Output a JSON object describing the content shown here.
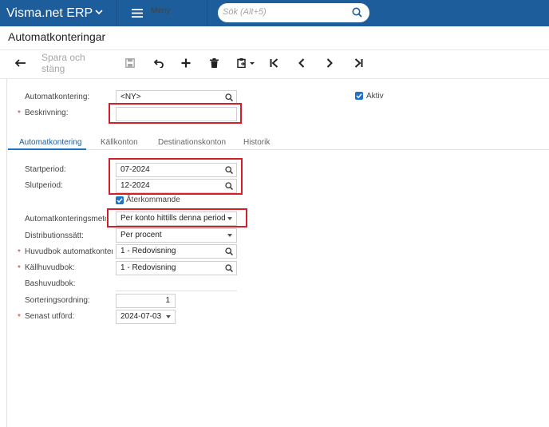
{
  "topbar": {
    "brand": "Visma.net ERP",
    "menu_label": "Meny",
    "search_placeholder": "Sök (Alt+5)"
  },
  "page": {
    "title": "Automatkonteringar"
  },
  "toolbar": {
    "save_close_label": "Spara och stäng"
  },
  "header": {
    "automatkontering_label": "Automatkontering:",
    "automatkontering_value": "<NY>",
    "beskrivning_label": "Beskrivning:",
    "beskrivning_value": "",
    "aktiv_label": "Aktiv",
    "aktiv_checked": true
  },
  "tabs": [
    {
      "label": "Automatkontering",
      "active": true
    },
    {
      "label": "Källkonton",
      "active": false
    },
    {
      "label": "Destinationskonton",
      "active": false
    },
    {
      "label": "Historik",
      "active": false
    }
  ],
  "form": {
    "startperiod_label": "Startperiod:",
    "startperiod_value": "07-2024",
    "slutperiod_label": "Slutperiod:",
    "slutperiod_value": "12-2024",
    "aterkommande_label": "Återkommande",
    "aterkommande_checked": true,
    "metod_label": "Automatkonteringsmetod",
    "metod_value": "Per konto hittills denna period",
    "distribution_label": "Distributionssätt:",
    "distribution_value": "Per procent",
    "huvudbok_label": "Huvudbok automatkonteri...",
    "huvudbok_value": "1 - Redovisning",
    "kallhuvudbok_label": "Källhuvudbok:",
    "kallhuvudbok_value": "1 - Redovisning",
    "bashuvudbok_label": "Bashuvudbok:",
    "bashuvudbok_value": "",
    "sortering_label": "Sorteringsordning:",
    "sortering_value": "1",
    "senast_label": "Senast utförd:",
    "senast_value": "2024-07-03"
  },
  "colors": {
    "topbar": "#1d5d9b",
    "accent": "#1d73c4",
    "highlight": "#d21f2a",
    "required": "#c0392b"
  }
}
